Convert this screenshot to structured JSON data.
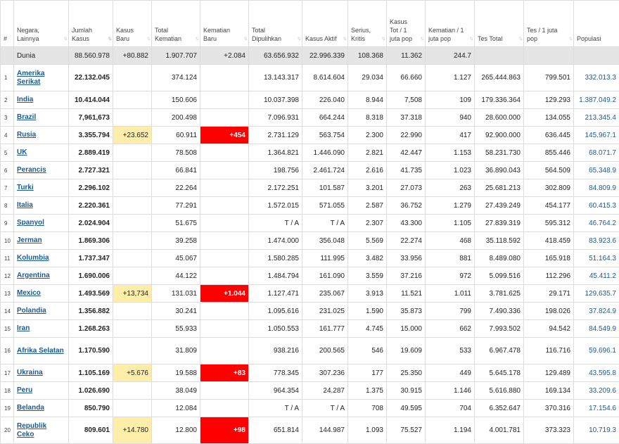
{
  "headers": [
    {
      "label": "#",
      "sort": false
    },
    {
      "label": "Negara, Lainnya",
      "sort": true
    },
    {
      "label": "Jumlah Kasus",
      "sort": true,
      "active": true
    },
    {
      "label": "Kasus Baru",
      "sort": true
    },
    {
      "label": "Total Kematian",
      "sort": true
    },
    {
      "label": "Kematian Baru",
      "sort": true
    },
    {
      "label": "Total Dipulihkan",
      "sort": true
    },
    {
      "label": "Kasus Aktif",
      "sort": true
    },
    {
      "label": "Serius, Kritis",
      "sort": true
    },
    {
      "label": "Kasus Tot / 1 juta pop",
      "sort": true
    },
    {
      "label": "Kematian / 1 juta pop",
      "sort": true
    },
    {
      "label": "Tes Total",
      "sort": true
    },
    {
      "label": "Tes / 1 juta pop",
      "sort": true
    },
    {
      "label": "Populasi",
      "sort": false
    }
  ],
  "world": {
    "num": "",
    "country": "Dunia",
    "total_cases": "88.560.978",
    "new_cases": "+80.882",
    "total_deaths": "1.907.707",
    "new_deaths": "+2.084",
    "recovered": "63.656.932",
    "active": "22.996.339",
    "critical": "108.368",
    "cases_per_m": "11.362",
    "deaths_per_m": "244.7",
    "tests": "",
    "tests_per_m": "",
    "population": ""
  },
  "rows": [
    {
      "num": "1",
      "country": "Amerika Serikat",
      "total_cases": "22.132.045",
      "new_cases": "",
      "total_deaths": "374.124",
      "new_deaths": "",
      "recovered": "13.143.317",
      "active": "8.614.604",
      "critical": "29.034",
      "cases_per_m": "66.660",
      "deaths_per_m": "1.127",
      "tests": "265.444.863",
      "tests_per_m": "799.501",
      "population": "332.013.3"
    },
    {
      "num": "2",
      "country": "India",
      "total_cases": "10.414.044",
      "new_cases": "",
      "total_deaths": "150.606",
      "new_deaths": "",
      "recovered": "10.037.398",
      "active": "226.040",
      "critical": "8.944",
      "cases_per_m": "7,508",
      "deaths_per_m": "109",
      "tests": "179.336.364",
      "tests_per_m": "129.293",
      "population": "1.387.049.2"
    },
    {
      "num": "3",
      "country": "Brazil",
      "total_cases": "7,961,673",
      "new_cases": "",
      "total_deaths": "200.498",
      "new_deaths": "",
      "recovered": "7.096.931",
      "active": "664.244",
      "critical": "8.318",
      "cases_per_m": "37.318",
      "deaths_per_m": "940",
      "tests": "28.600.000",
      "tests_per_m": "134.055",
      "population": "213.345.4"
    },
    {
      "num": "4",
      "country": "Rusia",
      "total_cases": "3.355.794",
      "new_cases": "+23.652",
      "total_deaths": "60.911",
      "new_deaths": "+454",
      "recovered": "2.731.129",
      "active": "563.754",
      "critical": "2.300",
      "cases_per_m": "22.990",
      "deaths_per_m": "417",
      "tests": "92.900.000",
      "tests_per_m": "636.445",
      "population": "145.967.1"
    },
    {
      "num": "5",
      "country": "UK",
      "total_cases": "2.889.419",
      "new_cases": "",
      "total_deaths": "78.508",
      "new_deaths": "",
      "recovered": "1.364.821",
      "active": "1.446.090",
      "critical": "2.821",
      "cases_per_m": "42.447",
      "deaths_per_m": "1.153",
      "tests": "58.231.730",
      "tests_per_m": "855.446",
      "population": "68.071.7"
    },
    {
      "num": "6",
      "country": "Perancis",
      "total_cases": "2.727.321",
      "new_cases": "",
      "total_deaths": "66.841",
      "new_deaths": "",
      "recovered": "198.756",
      "active": "2.461.724",
      "critical": "2.616",
      "cases_per_m": "41.735",
      "deaths_per_m": "1.023",
      "tests": "36.890.043",
      "tests_per_m": "564.509",
      "population": "65.348.9"
    },
    {
      "num": "7",
      "country": "Turki",
      "total_cases": "2.296.102",
      "new_cases": "",
      "total_deaths": "22.264",
      "new_deaths": "",
      "recovered": "2.172.251",
      "active": "101.587",
      "critical": "3.201",
      "cases_per_m": "27.073",
      "deaths_per_m": "263",
      "tests": "25.681.213",
      "tests_per_m": "302.809",
      "population": "84.809.9"
    },
    {
      "num": "8",
      "country": "Italia",
      "total_cases": "2.220.361",
      "new_cases": "",
      "total_deaths": "77.291",
      "new_deaths": "",
      "recovered": "1.572.015",
      "active": "571.055",
      "critical": "2.587",
      "cases_per_m": "36.752",
      "deaths_per_m": "1.279",
      "tests": "27.439.249",
      "tests_per_m": "454.177",
      "population": "60.415.3"
    },
    {
      "num": "9",
      "country": "Spanyol",
      "total_cases": "2.024.904",
      "new_cases": "",
      "total_deaths": "51.675",
      "new_deaths": "",
      "recovered": "T / A",
      "active": "T / A",
      "critical": "2.307",
      "cases_per_m": "43.300",
      "deaths_per_m": "1.105",
      "tests": "27.839.319",
      "tests_per_m": "595.312",
      "population": "46.764.2"
    },
    {
      "num": "10",
      "country": "Jerman",
      "total_cases": "1.869.306",
      "new_cases": "",
      "total_deaths": "39.258",
      "new_deaths": "",
      "recovered": "1.474.000",
      "active": "356.048",
      "critical": "5.569",
      "cases_per_m": "22.274",
      "deaths_per_m": "468",
      "tests": "35.118.592",
      "tests_per_m": "418.459",
      "population": "83.923.6"
    },
    {
      "num": "11",
      "country": "Kolumbia",
      "total_cases": "1.737.347",
      "new_cases": "",
      "total_deaths": "45.067",
      "new_deaths": "",
      "recovered": "1.580.285",
      "active": "111.995",
      "critical": "3.482",
      "cases_per_m": "33.956",
      "deaths_per_m": "881",
      "tests": "8.489.080",
      "tests_per_m": "165.918",
      "population": "51.164.3"
    },
    {
      "num": "12",
      "country": "Argentina",
      "total_cases": "1.690.006",
      "new_cases": "",
      "total_deaths": "44.122",
      "new_deaths": "",
      "recovered": "1.484.794",
      "active": "161.090",
      "critical": "3.559",
      "cases_per_m": "37.216",
      "deaths_per_m": "972",
      "tests": "5.099.516",
      "tests_per_m": "112.296",
      "population": "45.411.2"
    },
    {
      "num": "13",
      "country": "Mexico",
      "total_cases": "1.493.569",
      "new_cases": "+13,734",
      "total_deaths": "131.031",
      "new_deaths": "+1.044",
      "recovered": "1.127.471",
      "active": "235.067",
      "critical": "3.913",
      "cases_per_m": "11.521",
      "deaths_per_m": "1.011",
      "tests": "3.781.625",
      "tests_per_m": "29.171",
      "population": "129.635.7"
    },
    {
      "num": "14",
      "country": "Polandia",
      "total_cases": "1.356.882",
      "new_cases": "",
      "total_deaths": "30.241",
      "new_deaths": "",
      "recovered": "1.095.616",
      "active": "231.025",
      "critical": "1.590",
      "cases_per_m": "35.873",
      "deaths_per_m": "799",
      "tests": "7.490.336",
      "tests_per_m": "198.026",
      "population": "37.824.9"
    },
    {
      "num": "15",
      "country": "Iran",
      "total_cases": "1.268.263",
      "new_cases": "",
      "total_deaths": "55.933",
      "new_deaths": "",
      "recovered": "1.050.553",
      "active": "161.777",
      "critical": "4.745",
      "cases_per_m": "15.000",
      "deaths_per_m": "662",
      "tests": "7.993.502",
      "tests_per_m": "94.542",
      "population": "84.549.9"
    },
    {
      "num": "16",
      "country": "Afrika Selatan",
      "total_cases": "1.170.590",
      "new_cases": "",
      "total_deaths": "31.809",
      "new_deaths": "",
      "recovered": "938.216",
      "active": "200.565",
      "critical": "546",
      "cases_per_m": "19.609",
      "deaths_per_m": "533",
      "tests": "6.967.478",
      "tests_per_m": "116.716",
      "population": "59.696.1"
    },
    {
      "num": "17",
      "country": "Ukraina",
      "total_cases": "1.105.169",
      "new_cases": "+5.676",
      "total_deaths": "19.588",
      "new_deaths": "+83",
      "recovered": "778.345",
      "active": "307.236",
      "critical": "177",
      "cases_per_m": "25.350",
      "deaths_per_m": "449",
      "tests": "5.645.178",
      "tests_per_m": "129.489",
      "population": "43.595.8"
    },
    {
      "num": "18",
      "country": "Peru",
      "total_cases": "1.026.690",
      "new_cases": "",
      "total_deaths": "38.049",
      "new_deaths": "",
      "recovered": "964.354",
      "active": "24.287",
      "critical": "1.375",
      "cases_per_m": "30.915",
      "deaths_per_m": "1.146",
      "tests": "5.616.880",
      "tests_per_m": "169.134",
      "population": "33.209.6"
    },
    {
      "num": "19",
      "country": "Belanda",
      "total_cases": "850.790",
      "new_cases": "",
      "total_deaths": "12.084",
      "new_deaths": "",
      "recovered": "T / A",
      "active": "T / A",
      "critical": "708",
      "cases_per_m": "49.595",
      "deaths_per_m": "704",
      "tests": "6.352.647",
      "tests_per_m": "370.316",
      "population": "17.154.6"
    },
    {
      "num": "20",
      "country": "Republik Ceko",
      "total_cases": "809.601",
      "new_cases": "+14.780",
      "total_deaths": "12.800",
      "new_deaths": "+98",
      "recovered": "651.814",
      "active": "144.987",
      "critical": "1.093",
      "cases_per_m": "75.527",
      "deaths_per_m": "1.194",
      "tests": "4.001.781",
      "tests_per_m": "373.323",
      "population": "10.719.3"
    }
  ]
}
